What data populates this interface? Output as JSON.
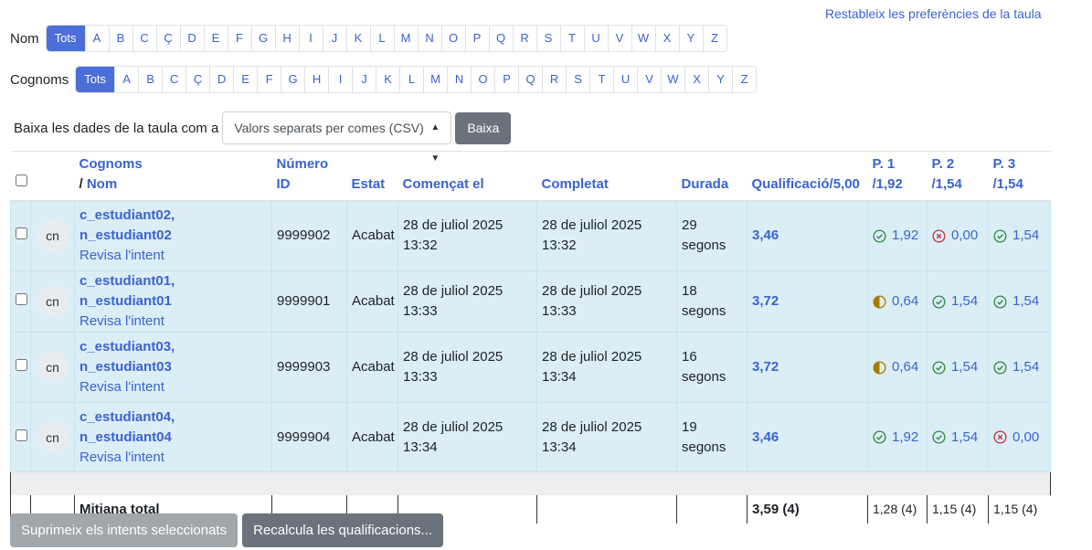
{
  "reset_link": "Restableix les preferències de la taula",
  "first_name_bar": {
    "label": "Nom",
    "letters": [
      "Tots",
      "A",
      "B",
      "C",
      "Ç",
      "D",
      "E",
      "F",
      "G",
      "H",
      "I",
      "J",
      "K",
      "L",
      "M",
      "N",
      "O",
      "P",
      "Q",
      "R",
      "S",
      "T",
      "U",
      "V",
      "W",
      "X",
      "Y",
      "Z"
    ]
  },
  "last_name_bar": {
    "label": "Cognoms",
    "letters": [
      "Tots",
      "A",
      "B",
      "C",
      "Ç",
      "D",
      "E",
      "F",
      "G",
      "H",
      "I",
      "J",
      "K",
      "L",
      "M",
      "N",
      "O",
      "P",
      "Q",
      "R",
      "S",
      "T",
      "U",
      "V",
      "W",
      "X",
      "Y",
      "Z"
    ]
  },
  "download": {
    "label": "Baixa les dades de la taula com a",
    "format": "Valors separats per comes (CSV)",
    "button": "Baixa"
  },
  "headers": {
    "surname": "Cognoms",
    "slash_name": "/ ",
    "name": "Nom",
    "id_line1": "Número",
    "id_line2": "ID",
    "state": "Estat",
    "started": "Començat el",
    "completed": "Completat",
    "duration": "Durada",
    "grade": "Qualificació/5,00",
    "q1_a": "P. 1",
    "q1_b": "/1,92",
    "q2_a": "P. 2",
    "q2_b": "/1,54",
    "q3_a": "P. 3",
    "q3_b": "/1,54"
  },
  "rows": [
    {
      "initials": "cn",
      "name_line1": "c_estudiant02,",
      "name_line2": "n_estudiant02",
      "review": "Revisa l'intent",
      "id": "9999902",
      "state": "Acabat",
      "started_date": "28 de juliol 2025",
      "started_time": "13:32",
      "completed_date": "28 de juliol 2025",
      "completed_time": "13:32",
      "duration_line1": "29",
      "duration_line2": "segons",
      "grade": "3,46",
      "q1": {
        "status": "correct",
        "value": "1,92"
      },
      "q2": {
        "status": "incorrect",
        "value": "0,00"
      },
      "q3": {
        "status": "correct",
        "value": "1,54"
      }
    },
    {
      "initials": "cn",
      "name_line1": "c_estudiant01, n_estudiant01",
      "name_line2": "",
      "review": "Revisa l'intent",
      "id": "9999901",
      "state": "Acabat",
      "started_date": "28 de juliol 2025",
      "started_time": "13:33",
      "completed_date": "28 de juliol 2025",
      "completed_time": "13:33",
      "duration_line1": "18 segons",
      "duration_line2": "",
      "grade": "3,72",
      "q1": {
        "status": "partial",
        "value": "0,64"
      },
      "q2": {
        "status": "correct",
        "value": "1,54"
      },
      "q3": {
        "status": "correct",
        "value": "1,54"
      }
    },
    {
      "initials": "cn",
      "name_line1": "c_estudiant03,",
      "name_line2": "n_estudiant03",
      "review": "Revisa l'intent",
      "id": "9999903",
      "state": "Acabat",
      "started_date": "28 de juliol 2025",
      "started_time": "13:33",
      "completed_date": "28 de juliol 2025",
      "completed_time": "13:34",
      "duration_line1": "16 segons",
      "duration_line2": "",
      "grade": "3,72",
      "q1": {
        "status": "partial",
        "value": "0,64"
      },
      "q2": {
        "status": "correct",
        "value": "1,54"
      },
      "q3": {
        "status": "correct",
        "value": "1,54"
      }
    },
    {
      "initials": "cn",
      "name_line1": "c_estudiant04,",
      "name_line2": "n_estudiant04",
      "review": "Revisa l'intent",
      "id": "9999904",
      "state": "Acabat",
      "started_date": "28 de juliol 2025",
      "started_time": "13:34",
      "completed_date": "28 de juliol 2025",
      "completed_time": "13:34",
      "duration_line1": "19 segons",
      "duration_line2": "",
      "grade": "3,46",
      "q1": {
        "status": "correct",
        "value": "1,92"
      },
      "q2": {
        "status": "correct",
        "value": "1,54"
      },
      "q3": {
        "status": "incorrect",
        "value": "0,00"
      }
    }
  ],
  "totals": {
    "label": "Mitjana total",
    "grade": "3,59 (4)",
    "q1": "1,28 (4)",
    "q2": "1,15 (4)",
    "q3": "1,15 (4)"
  },
  "actions": {
    "delete": "Suprimeix els intents seleccionats",
    "regrade": "Recalcula les qualificacions..."
  },
  "colors": {
    "correct": "#2f8a3e",
    "incorrect": "#c0343f",
    "partial": "#a57c00",
    "link": "#3b63d1"
  }
}
